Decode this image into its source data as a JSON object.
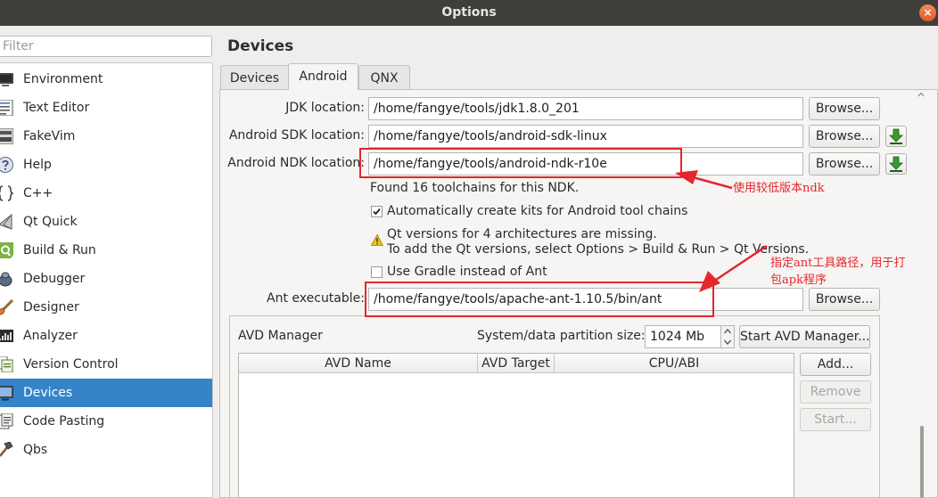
{
  "window": {
    "title": "Options",
    "close_glyph": "×"
  },
  "filter": {
    "placeholder": "Filter",
    "value": ""
  },
  "sidebar": {
    "items": [
      {
        "label": "Environment",
        "icon": "monitor-icon"
      },
      {
        "label": "Text Editor",
        "icon": "text-editor-icon"
      },
      {
        "label": "FakeVim",
        "icon": "fakevim-icon"
      },
      {
        "label": "Help",
        "icon": "help-icon"
      },
      {
        "label": "C++",
        "icon": "cpp-braces-icon"
      },
      {
        "label": "Qt Quick",
        "icon": "qt-quick-icon"
      },
      {
        "label": "Build & Run",
        "icon": "build-run-icon"
      },
      {
        "label": "Debugger",
        "icon": "debugger-icon"
      },
      {
        "label": "Designer",
        "icon": "designer-brush-icon"
      },
      {
        "label": "Analyzer",
        "icon": "analyzer-icon"
      },
      {
        "label": "Version Control",
        "icon": "version-control-icon"
      },
      {
        "label": "Devices",
        "icon": "devices-icon",
        "selected": true
      },
      {
        "label": "Code Pasting",
        "icon": "code-pasting-icon"
      },
      {
        "label": "Qbs",
        "icon": "qbs-hammer-icon"
      }
    ],
    "selected_color": "#3584c9"
  },
  "page": {
    "title": "Devices",
    "tabs": [
      {
        "label": "Devices"
      },
      {
        "label": "Android",
        "active": true
      },
      {
        "label": "QNX"
      }
    ]
  },
  "android": {
    "jdk": {
      "label": "JDK location:",
      "value": "/home/fangye/tools/jdk1.8.0_201",
      "browse": "Browse..."
    },
    "sdk": {
      "label": "Android SDK location:",
      "value": "/home/fangye/tools/android-sdk-linux",
      "browse": "Browse..."
    },
    "ndk": {
      "label": "Android NDK location:",
      "value": "/home/fangye/tools/android-ndk-r10e",
      "browse": "Browse..."
    },
    "ndk_info": "Found 16 toolchains for this NDK.",
    "auto_create_kits": {
      "label": "Automatically create kits for Android tool chains",
      "checked": true
    },
    "warning": {
      "line1": "Qt versions for 4 architectures are missing.",
      "line2": "To add the Qt versions, select Options > Build & Run > Qt Versions."
    },
    "use_gradle": {
      "label": "Use Gradle instead of Ant",
      "checked": false
    },
    "ant": {
      "label": "Ant executable:",
      "value": "/home/fangye/tools/apache-ant-1.10.5/bin/ant",
      "browse": "Browse..."
    }
  },
  "avd": {
    "group_label": "AVD Manager",
    "partition_label": "System/data partition size:",
    "partition_value": "1024 Mb",
    "start_manager": "Start AVD Manager...",
    "columns": [
      "AVD Name",
      "AVD Target",
      "CPU/ABI"
    ],
    "add": "Add...",
    "remove": "Remove",
    "start": "Start..."
  },
  "annotations": {
    "ndk_note": "使用较低版本ndk",
    "ant_note_line1": "指定ant工具路径，用于打",
    "ant_note_line2": "包apk程序",
    "color": "#e5262b"
  }
}
